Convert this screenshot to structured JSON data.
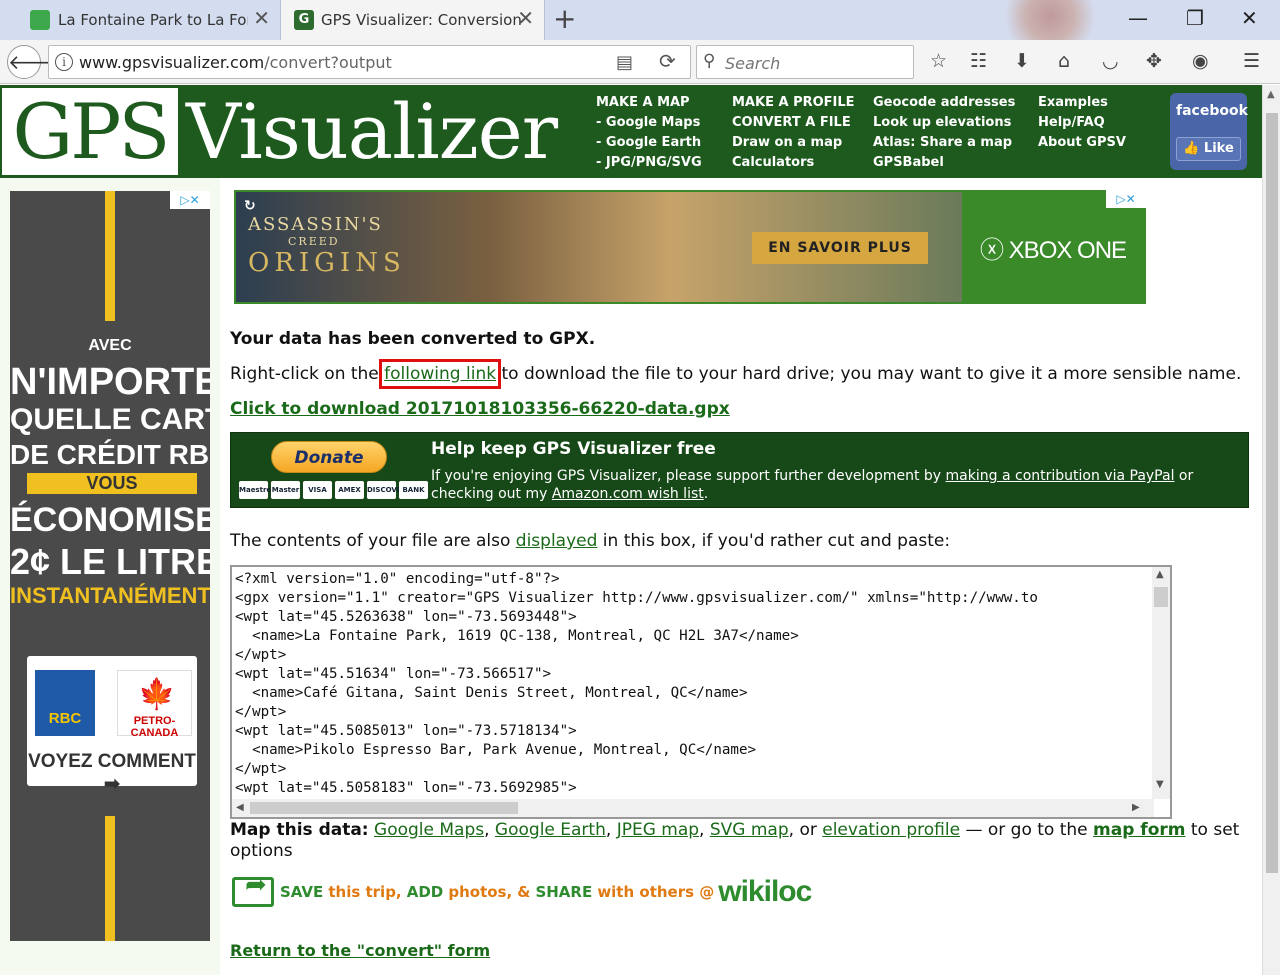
{
  "browser": {
    "tabs": [
      {
        "title": "La Fontaine Park to La Fontaine",
        "favicon": "google-maps-icon"
      },
      {
        "title": "GPS Visualizer: Conversion o",
        "favicon": "gps-visualizer-icon",
        "favicon_text": "G"
      }
    ],
    "url_host": "www.gpsvisualizer.com",
    "url_path": "/convert?output",
    "search_placeholder": "Search"
  },
  "header": {
    "logo_gps": "GPS",
    "logo_visualizer": "Visualizer",
    "nav": [
      [
        "MAKE A MAP",
        "- Google Maps",
        "- Google Earth",
        "- JPG/PNG/SVG"
      ],
      [
        "MAKE A PROFILE",
        "CONVERT A FILE",
        "Draw on a map",
        "Calculators"
      ],
      [
        "Geocode addresses",
        "Look up elevations",
        "Atlas: Share a map",
        "GPSBabel"
      ],
      [
        "Examples",
        "Help/FAQ",
        "About GPSV"
      ]
    ],
    "facebook": {
      "brand": "facebook",
      "like": "Like"
    }
  },
  "left_ad": {
    "line1": "AVEC",
    "line2": "N'IMPORTE",
    "line3": "QUELLE CARTE",
    "line4": "DE CRÉDIT RBC",
    "line5": "VOUS",
    "line6": "ÉCONOMISEZ",
    "line7": "2¢ LE LITRE",
    "line8": "INSTANTANÉMENT",
    "rbc": "RBC",
    "petro": "PETRO-CANADA",
    "cta": "VOYEZ COMMENT"
  },
  "banner_ad": {
    "brand1": "ASSASSIN'S",
    "brand2": "CREED",
    "brand3": "ORIGINS",
    "cta": "EN SAVOIR PLUS",
    "platform": "XBOX ONE"
  },
  "main": {
    "converted": "Your data has been converted to GPX.",
    "instr_pre": "Right-click on the ",
    "instr_link": "following link",
    "instr_post": " to download the file to your hard drive; you may want to give it a more sensible name.",
    "download_link": "Click to download 20171018103356-66220-data.gpx",
    "donate": {
      "button": "Donate",
      "cards": [
        "Maestro",
        "Master",
        "VISA",
        "AMEX",
        "DISCOVER",
        "BANK"
      ],
      "title": "Help keep GPS Visualizer free",
      "body_pre": "If you're enjoying GPS Visualizer, please support further development by ",
      "link1": "making a contribution via PayPal",
      "body_mid": " or checking out my ",
      "link2": "Amazon.com wish list",
      "body_post": "."
    },
    "contents_pre": "The contents of your file are also ",
    "contents_link": "displayed",
    "contents_post": " in this box, if you'd rather cut and paste:",
    "code": "<?xml version=\"1.0\" encoding=\"utf-8\"?>\n<gpx version=\"1.1\" creator=\"GPS Visualizer http://www.gpsvisualizer.com/\" xmlns=\"http://www.to\n<wpt lat=\"45.5263638\" lon=\"-73.5693448\">\n  <name>La Fontaine Park, 1619 QC-138, Montreal, QC H2L 3A7</name>\n</wpt>\n<wpt lat=\"45.51634\" lon=\"-73.566517\">\n  <name>Café Gitana, Saint Denis Street, Montreal, QC</name>\n</wpt>\n<wpt lat=\"45.5085013\" lon=\"-73.5718134\">\n  <name>Pikolo Espresso Bar, Park Avenue, Montreal, QC</name>\n</wpt>\n<wpt lat=\"45.5058183\" lon=\"-73.5692985\">",
    "map_label": "Map this data:",
    "map_links": [
      "Google Maps",
      "Google Earth",
      "JPEG map",
      "SVG map",
      "elevation profile"
    ],
    "map_sep1": ", ",
    "map_or": ", or ",
    "map_mid": " — or go to the ",
    "map_form": "map form",
    "map_post": " to set options",
    "wikiloc": {
      "save": "SAVE",
      "trip": "this trip,",
      "add": "ADD",
      "photos": "photos,",
      "amp": "&",
      "share": "SHARE",
      "with": "with others @",
      "logo": "wikiloc"
    },
    "return_link": "Return to the \"convert\" form"
  }
}
